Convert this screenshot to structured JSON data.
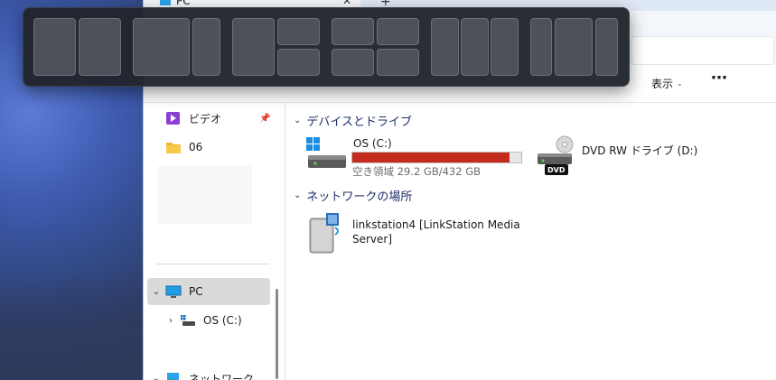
{
  "window": {
    "tab_title": "PC",
    "tab_close": "✕",
    "tab_add": "+"
  },
  "toolbar": {
    "view_label": "表示",
    "view_chevron": "⌄",
    "more_label": "⋯"
  },
  "nav": {
    "items": [
      {
        "label": "ビデオ",
        "icon": "video-folder-icon"
      },
      {
        "label": "06",
        "icon": "folder-icon"
      },
      {
        "label": "PC",
        "icon": "pc-icon",
        "expanded": true,
        "selected": true
      },
      {
        "label": "OS (C:)",
        "icon": "drive-icon"
      },
      {
        "label": "ネットワーク",
        "icon": "network-icon"
      }
    ]
  },
  "content": {
    "devices_header": "デバイスとドライブ",
    "network_header": "ネットワークの場所",
    "drive_c": {
      "name": "OS (C:)",
      "free_text": "空き領域 29.2 GB/432 GB",
      "used_fraction": 0.932
    },
    "dvd": {
      "name": "DVD RW ドライブ (D:)",
      "badge": "DVD"
    },
    "network_location": {
      "name_line1": "linkstation4 [LinkStation Media",
      "name_line2": "Server]"
    }
  },
  "colors": {
    "usage_fill": "#c42b1c",
    "selected_nav": "#dadada",
    "flyout_bg": "#20242c",
    "zone": "#4e5159"
  }
}
